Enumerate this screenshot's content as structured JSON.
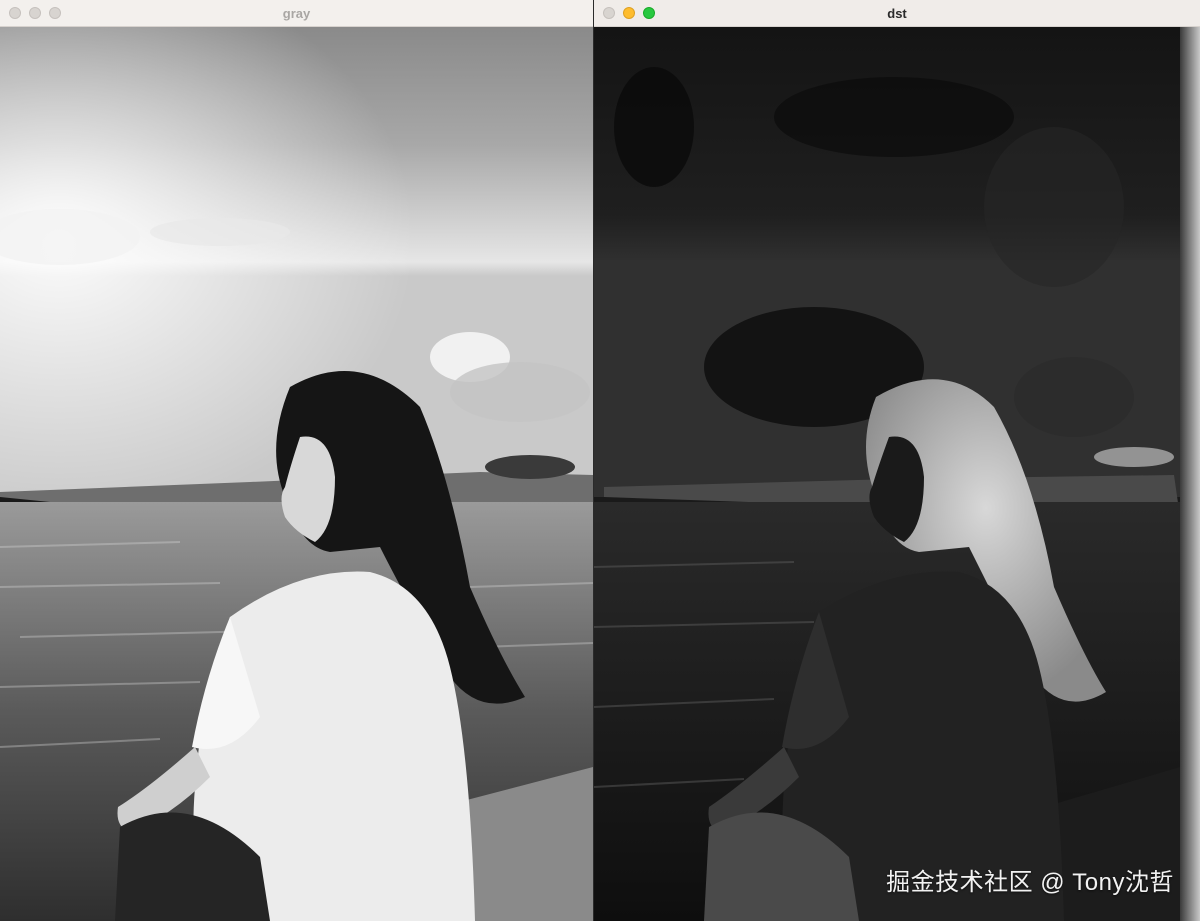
{
  "windows": [
    {
      "title": "gray",
      "active": false
    },
    {
      "title": "dst",
      "active": true
    }
  ],
  "watermark": "掘金技术社区 @ Tony沈哲",
  "icons": [
    "close-icon",
    "minimize-icon",
    "maximize-icon"
  ],
  "colors": {
    "close": "#ff5f57",
    "minimize": "#febc2e",
    "maximize": "#28c840",
    "inactive_light": "#d8d4d0",
    "titlebar": "#f0ece9"
  }
}
